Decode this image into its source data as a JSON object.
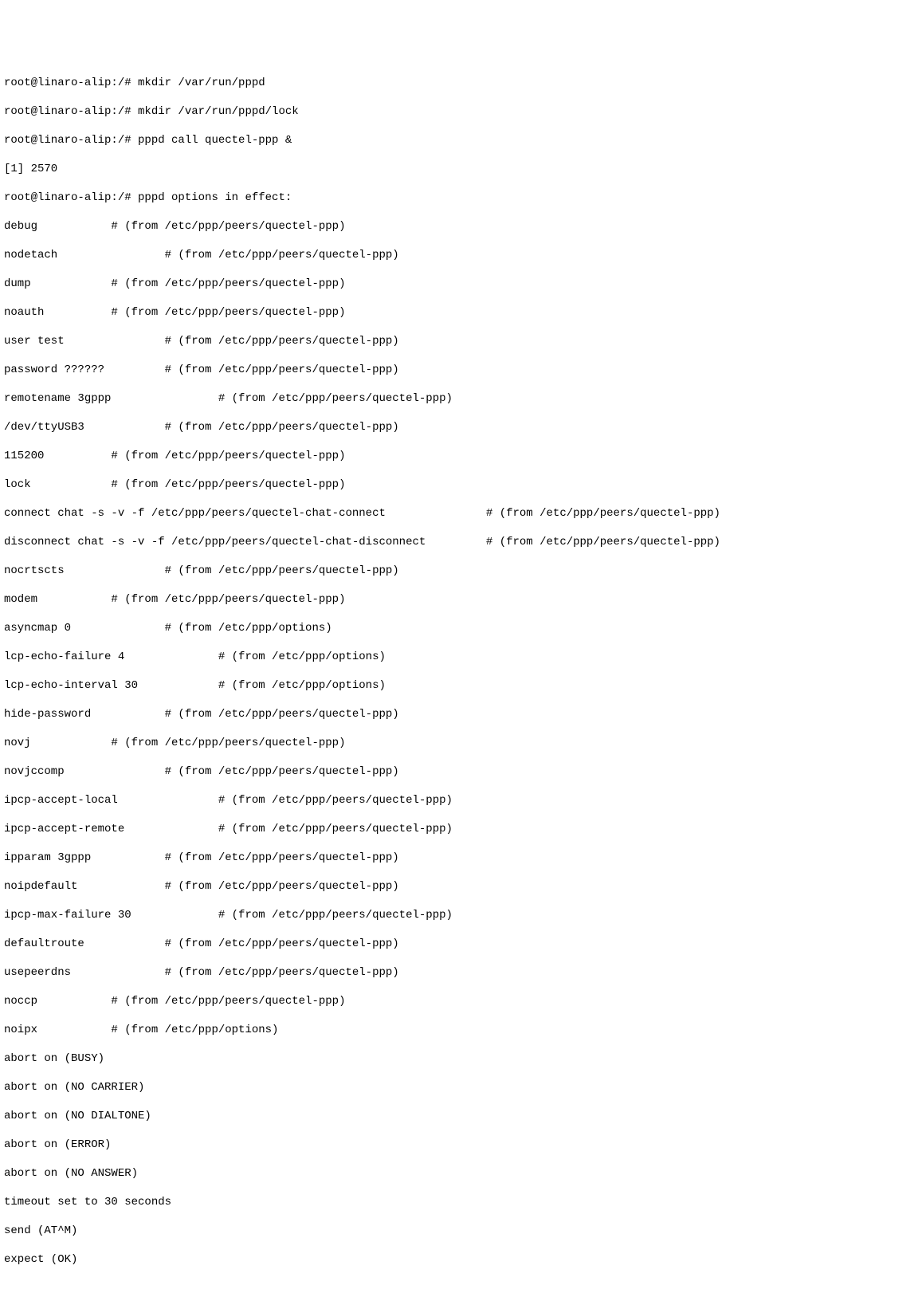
{
  "lines": {
    "l0": "root@linaro-alip:/# mkdir /var/run/pppd",
    "l1": "root@linaro-alip:/# mkdir /var/run/pppd/lock",
    "l2": "root@linaro-alip:/# pppd call quectel-ppp &",
    "l3": "[1] 2570",
    "l4": "root@linaro-alip:/# pppd options in effect:",
    "l5": "debug           # (from /etc/ppp/peers/quectel-ppp)",
    "l6": "nodetach                # (from /etc/ppp/peers/quectel-ppp)",
    "l7": "dump            # (from /etc/ppp/peers/quectel-ppp)",
    "l8": "noauth          # (from /etc/ppp/peers/quectel-ppp)",
    "l9": "user test               # (from /etc/ppp/peers/quectel-ppp)",
    "l10": "password ??????         # (from /etc/ppp/peers/quectel-ppp)",
    "l11": "remotename 3gppp                # (from /etc/ppp/peers/quectel-ppp)",
    "l12": "/dev/ttyUSB3            # (from /etc/ppp/peers/quectel-ppp)",
    "l13": "115200          # (from /etc/ppp/peers/quectel-ppp)",
    "l14": "lock            # (from /etc/ppp/peers/quectel-ppp)",
    "l15": "connect chat -s -v -f /etc/ppp/peers/quectel-chat-connect               # (from /etc/ppp/peers/quectel-ppp)",
    "l16": "disconnect chat -s -v -f /etc/ppp/peers/quectel-chat-disconnect         # (from /etc/ppp/peers/quectel-ppp)",
    "l17": "nocrtscts               # (from /etc/ppp/peers/quectel-ppp)",
    "l18": "modem           # (from /etc/ppp/peers/quectel-ppp)",
    "l19": "asyncmap 0              # (from /etc/ppp/options)",
    "l20": "lcp-echo-failure 4              # (from /etc/ppp/options)",
    "l21": "lcp-echo-interval 30            # (from /etc/ppp/options)",
    "l22": "hide-password           # (from /etc/ppp/peers/quectel-ppp)",
    "l23": "novj            # (from /etc/ppp/peers/quectel-ppp)",
    "l24": "novjccomp               # (from /etc/ppp/peers/quectel-ppp)",
    "l25": "ipcp-accept-local               # (from /etc/ppp/peers/quectel-ppp)",
    "l26": "ipcp-accept-remote              # (from /etc/ppp/peers/quectel-ppp)",
    "l27": "ipparam 3gppp           # (from /etc/ppp/peers/quectel-ppp)",
    "l28": "noipdefault             # (from /etc/ppp/peers/quectel-ppp)",
    "l29": "ipcp-max-failure 30             # (from /etc/ppp/peers/quectel-ppp)",
    "l30": "defaultroute            # (from /etc/ppp/peers/quectel-ppp)",
    "l31": "usepeerdns              # (from /etc/ppp/peers/quectel-ppp)",
    "l32": "noccp           # (from /etc/ppp/peers/quectel-ppp)",
    "l33": "noipx           # (from /etc/ppp/options)",
    "l34": "abort on (BUSY)",
    "l35": "abort on (NO CARRIER)",
    "l36": "abort on (NO DIALTONE)",
    "l37": "abort on (ERROR)",
    "l38": "abort on (NO ANSWER)",
    "l39": "timeout set to 30 seconds",
    "l40": "send (AT^M)",
    "l41": "expect (OK)"
  }
}
